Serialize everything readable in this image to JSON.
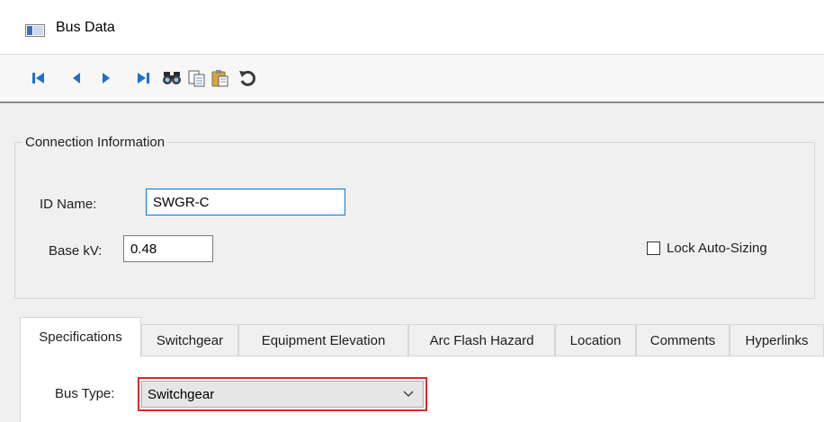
{
  "window": {
    "title": "Bus Data"
  },
  "toolbar": {
    "buttons": [
      {
        "icon": "first-record-icon"
      },
      {
        "icon": "previous-record-icon"
      },
      {
        "icon": "next-record-icon"
      },
      {
        "icon": "last-record-icon"
      },
      {
        "icon": "find-icon"
      },
      {
        "icon": "copy-icon"
      },
      {
        "icon": "paste-icon"
      },
      {
        "icon": "undo-icon"
      }
    ]
  },
  "connection": {
    "legend": "Connection Information",
    "id_label": "ID Name:",
    "id_value": "SWGR-C",
    "basekv_label": "Base kV:",
    "basekv_value": "0.48",
    "lock_label": "Lock Auto-Sizing",
    "lock_checked": false
  },
  "tabs": [
    {
      "label": "Specifications",
      "active": true
    },
    {
      "label": "Switchgear",
      "active": false
    },
    {
      "label": "Equipment Elevation",
      "active": false
    },
    {
      "label": "Arc Flash Hazard",
      "active": false
    },
    {
      "label": "Location",
      "active": false
    },
    {
      "label": "Comments",
      "active": false
    },
    {
      "label": "Hyperlinks",
      "active": false
    }
  ],
  "specifications": {
    "bus_type_label": "Bus Type:",
    "bus_type_value": "Switchgear"
  },
  "colors": {
    "nav_blue": "#1f6fd1",
    "highlight_red": "#d92b2b",
    "focus_blue": "#0078d7"
  }
}
